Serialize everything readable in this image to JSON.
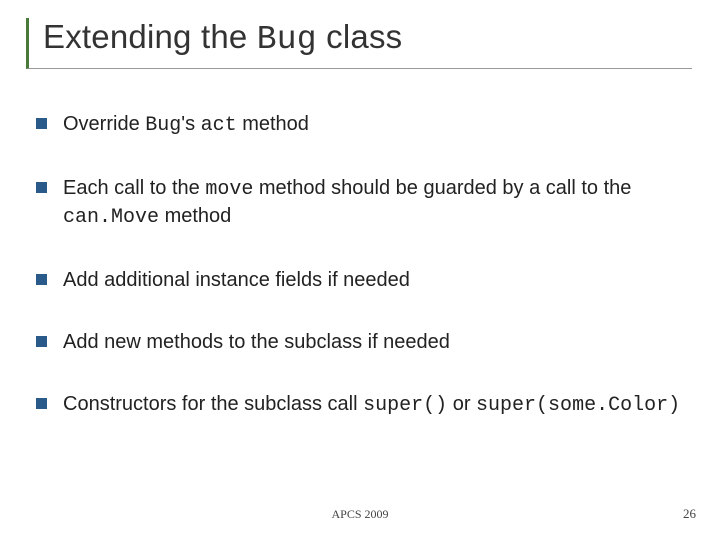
{
  "title": {
    "prefix": "Extending the ",
    "code": "Bug",
    "suffix": " class"
  },
  "bullets": [
    {
      "parts": [
        {
          "t": "Override ",
          "mono": false
        },
        {
          "t": "Bug",
          "mono": true
        },
        {
          "t": "'s ",
          "mono": false
        },
        {
          "t": "act",
          "mono": true
        },
        {
          "t": " method",
          "mono": false
        }
      ]
    },
    {
      "parts": [
        {
          "t": "Each call to the ",
          "mono": false
        },
        {
          "t": "move",
          "mono": true
        },
        {
          "t": " method should be guarded by a call to the ",
          "mono": false
        },
        {
          "t": "can.Move",
          "mono": true
        },
        {
          "t": " method",
          "mono": false
        }
      ]
    },
    {
      "parts": [
        {
          "t": "Add additional instance fields if needed",
          "mono": false
        }
      ]
    },
    {
      "parts": [
        {
          "t": "Add new methods to the subclass if needed",
          "mono": false
        }
      ]
    },
    {
      "parts": [
        {
          "t": "Constructors for the subclass call ",
          "mono": false
        },
        {
          "t": "super()",
          "mono": true
        },
        {
          "t": " or ",
          "mono": false
        },
        {
          "t": "super(some.Color)",
          "mono": true
        }
      ]
    }
  ],
  "footer": {
    "center": "APCS 2009",
    "page": "26"
  }
}
